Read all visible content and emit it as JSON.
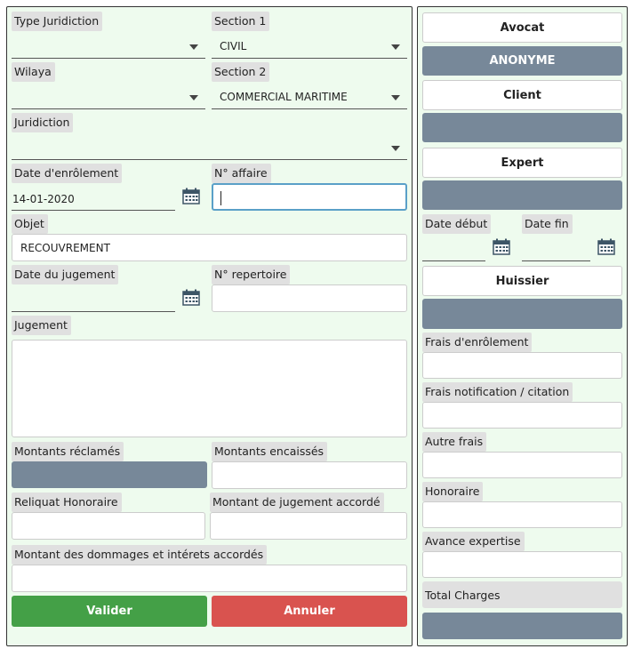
{
  "form": {
    "type_juridiction": {
      "label": "Type Juridiction",
      "value": ""
    },
    "section1": {
      "label": "Section 1",
      "value": "CIVIL"
    },
    "wilaya": {
      "label": "Wilaya",
      "value": ""
    },
    "section2": {
      "label": "Section 2",
      "value": "COMMERCIAL MARITIME"
    },
    "juridiction": {
      "label": "Juridiction",
      "value": ""
    },
    "date_enrolement": {
      "label": "Date d'enrôlement",
      "value": "14-01-2020"
    },
    "num_affaire": {
      "label": "N° affaire",
      "value": ""
    },
    "objet": {
      "label": "Objet",
      "value": "RECOUVREMENT"
    },
    "date_jugement": {
      "label": "Date du jugement",
      "value": ""
    },
    "num_repertoire": {
      "label": "N° repertoire",
      "value": ""
    },
    "jugement": {
      "label": "Jugement",
      "value": ""
    },
    "montants_reclames": {
      "label": "Montants réclamés"
    },
    "montants_encaisses": {
      "label": "Montants encaissés",
      "value": ""
    },
    "reliquat_honoraire": {
      "label": "Reliquat Honoraire",
      "value": ""
    },
    "montant_jugement_accorde": {
      "label": "Montant de jugement accordé",
      "value": ""
    },
    "montant_dommages": {
      "label": "Montant des dommages et intérets accordés",
      "value": ""
    },
    "valider_label": "Valider",
    "annuler_label": "Annuler"
  },
  "sidebar": {
    "avocat_label": "Avocat",
    "avocat_value": "ANONYME",
    "client_label": "Client",
    "expert_label": "Expert",
    "date_debut_label": "Date début",
    "date_fin_label": "Date fin",
    "huissier_label": "Huissier",
    "frais_enrolement_label": "Frais d'enrôlement",
    "frais_notification_label": "Frais notification / citation",
    "autre_frais_label": "Autre frais",
    "honoraire_label": "Honoraire",
    "avance_expertise_label": "Avance expertise",
    "total_charges_label": "Total Charges"
  },
  "colors": {
    "panel_bg": "#eefbee",
    "slate": "#778899",
    "valider": "#44a047",
    "annuler": "#d9534f",
    "focus": "#5aa0c8"
  },
  "icons": [
    "calendar-icon",
    "chevron-down-icon"
  ]
}
